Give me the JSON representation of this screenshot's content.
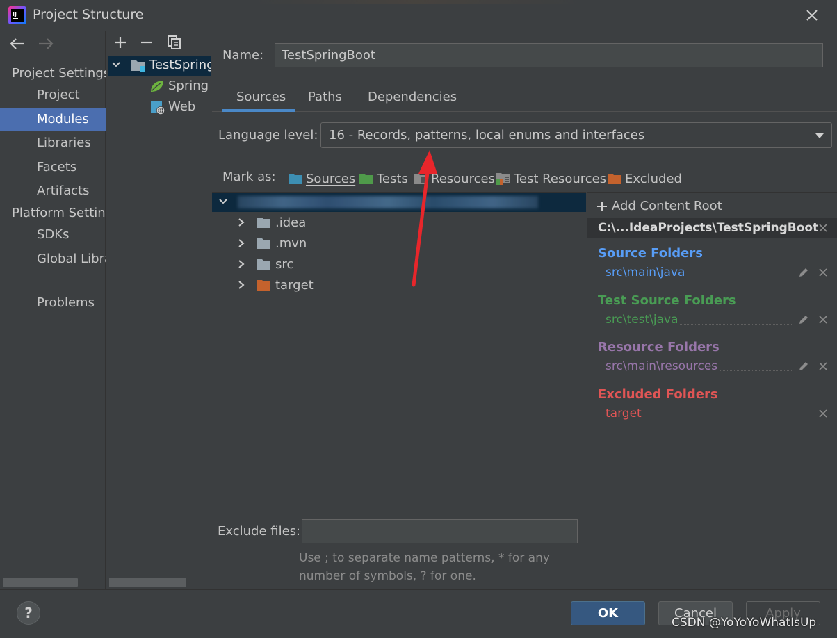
{
  "window": {
    "title": "Project Structure"
  },
  "sidebar": {
    "project_settings_heading": "Project Settings",
    "platform_settings_heading": "Platform Settings",
    "items": [
      {
        "label": "Project"
      },
      {
        "label": "Modules",
        "selected": true
      },
      {
        "label": "Libraries"
      },
      {
        "label": "Facets"
      },
      {
        "label": "Artifacts"
      },
      {
        "label": "SDKs"
      },
      {
        "label": "Global Libraries"
      },
      {
        "label": "Problems"
      }
    ]
  },
  "modules": {
    "toolbar": {
      "add": "add-icon",
      "remove": "minus-icon",
      "copy": "copy-icon"
    },
    "tree": [
      {
        "label": "TestSpringBoot",
        "icon": "module-folder-icon",
        "expanded": true
      },
      {
        "label": "Spring",
        "icon": "spring-leaf-icon"
      },
      {
        "label": "Web",
        "icon": "web-icon"
      }
    ]
  },
  "module_settings": {
    "name_label": "Name:",
    "name_value": "TestSpringBoot",
    "tabs": [
      {
        "label": "Sources",
        "active": true
      },
      {
        "label": "Paths"
      },
      {
        "label": "Dependencies"
      }
    ],
    "language_level_label": "Language level:",
    "language_level_value": "16 - Records, patterns, local enums and interfaces",
    "mark_as_label": "Mark as:",
    "mark_as": [
      {
        "label": "Sources",
        "color": "#3d8fb3"
      },
      {
        "label": "Tests",
        "color": "#4f9a4a"
      },
      {
        "label": "Resources",
        "color": "#8a8a8a"
      },
      {
        "label": "Test Resources",
        "color": "#8a8a8a"
      },
      {
        "label": "Excluded",
        "color": "#c4622d"
      }
    ],
    "file_tree": [
      {
        "label": ".idea",
        "color": "#9aa7b0"
      },
      {
        "label": ".mvn",
        "color": "#9aa7b0"
      },
      {
        "label": "src",
        "color": "#9aa7b0"
      },
      {
        "label": "target",
        "color": "#c4622d"
      }
    ],
    "exclude_files_label": "Exclude files:",
    "exclude_files_value": "",
    "exclude_hint_1": "Use ; to separate name patterns, * for any",
    "exclude_hint_2": "number of symbols, ? for one."
  },
  "content_root": {
    "add_label": "Add Content Root",
    "root_path": "C:\\...IdeaProjects\\TestSpringBoot",
    "groups": [
      {
        "heading": "Source Folders",
        "color": "#589df6",
        "item": "src\\main\\java",
        "editable": true
      },
      {
        "heading": "Test Source Folders",
        "color": "#499c54",
        "item": "src\\test\\java",
        "editable": true
      },
      {
        "heading": "Resource Folders",
        "color": "#9876aa",
        "item": "src\\main\\resources",
        "editable": true
      },
      {
        "heading": "Excluded Folders",
        "color": "#e05555",
        "item": "target",
        "editable": false
      }
    ]
  },
  "footer": {
    "help_label": "?",
    "ok_label": "OK",
    "cancel_label": "Cancel",
    "apply_label": "Apply",
    "watermark": "CSDN @YoYoYoWhatIsUp"
  }
}
